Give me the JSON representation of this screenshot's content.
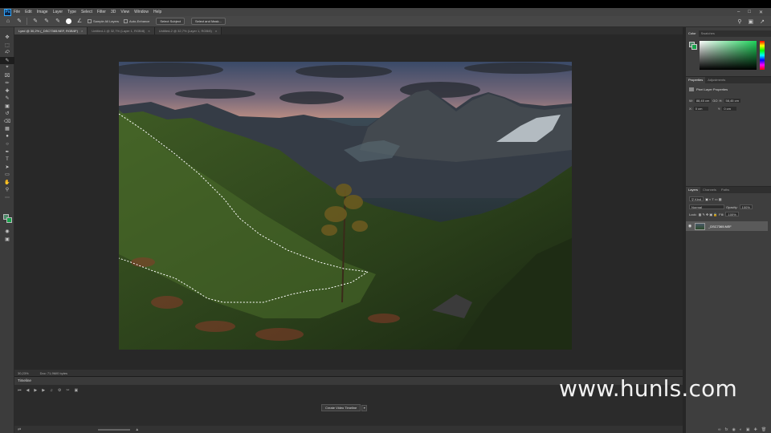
{
  "menubar": {
    "items": [
      "File",
      "Edit",
      "Image",
      "Layer",
      "Type",
      "Select",
      "Filter",
      "3D",
      "View",
      "Window",
      "Help"
    ],
    "logo": "Ps"
  },
  "options": {
    "sample_all_layers": "Sample All Layers",
    "auto_enhance": "Auto-Enhance",
    "select_subject": "Select Subject",
    "select_and_mask": "Select and Mask..."
  },
  "tabs": [
    {
      "label": "Lyed @ 30,2% (_DSC7365.NEF, RGB/8*)",
      "active": true
    },
    {
      "label": "Untitled-1 @ 32,7% (Layer 1, RGB/8)",
      "active": false
    },
    {
      "label": "Untitled-2 @ 32,7% (Layer 1, RGB/8)",
      "active": false
    }
  ],
  "status": {
    "zoom": "30,23%",
    "doc": "Doc: 71,9M/0 bytes"
  },
  "timeline": {
    "title": "Timeline",
    "create_button": "Create Video Timeline"
  },
  "color_panel": {
    "tabs": [
      "Color",
      "Swatches"
    ],
    "fg": "#4b8a68",
    "bg": "#16a34a"
  },
  "properties": {
    "tabs": [
      "Properties",
      "Adjustments"
    ],
    "title": "Pixel Layer Properties",
    "w_label": "W:",
    "w": "88,45 cm",
    "go_label": "GO",
    "h_label": "H:",
    "h": "58,45 cm",
    "x_label": "X:",
    "x": "0 cm",
    "y_label": "Y:",
    "y": "0 cm"
  },
  "layers": {
    "tabs": [
      "Layers",
      "Channels",
      "Paths"
    ],
    "kind": "Kind",
    "blend": "Normal",
    "opacity_label": "Opacity:",
    "opacity": "100%",
    "lock_label": "Lock:",
    "fill_label": "Fill:",
    "fill": "100%",
    "layer_name": "_DSC7365.NEF"
  },
  "watermark": "www.hunls.com"
}
